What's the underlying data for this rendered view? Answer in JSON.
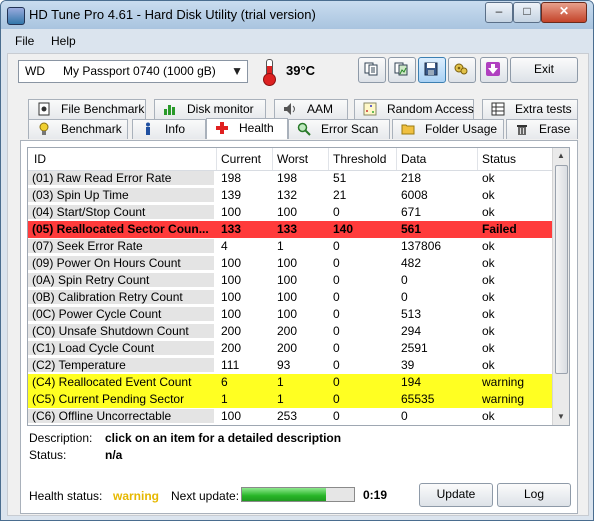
{
  "window": {
    "title": "HD Tune Pro 4.61 - Hard Disk Utility (trial version)",
    "minimize": "–",
    "maximize": "□",
    "close": "✕"
  },
  "menu": {
    "file": "File",
    "help": "Help"
  },
  "toolbar": {
    "drive_brand": "WD",
    "drive_model": "My Passport 0740 (1000 gB)",
    "temperature": "39°C",
    "exit_label": "Exit",
    "icons": [
      "copy-text-icon",
      "copy-screenshot-icon",
      "save-icon",
      "options-icon",
      "download-icon"
    ]
  },
  "tabs_top": [
    {
      "label": "File Benchmark",
      "icon": "file-benchmark-icon"
    },
    {
      "label": "Disk monitor",
      "icon": "disk-monitor-icon"
    },
    {
      "label": "AAM",
      "icon": "speaker-icon"
    },
    {
      "label": "Random Access",
      "icon": "random-access-icon"
    },
    {
      "label": "Extra tests",
      "icon": "extra-tests-icon"
    }
  ],
  "tabs_bottom": [
    {
      "label": "Benchmark",
      "icon": "bulb-icon"
    },
    {
      "label": "Info",
      "icon": "info-icon"
    },
    {
      "label": "Health",
      "icon": "health-cross-icon",
      "active": true
    },
    {
      "label": "Error Scan",
      "icon": "magnifier-icon"
    },
    {
      "label": "Folder Usage",
      "icon": "folder-icon"
    },
    {
      "label": "Erase",
      "icon": "trash-icon"
    }
  ],
  "table": {
    "headers": [
      "ID",
      "Current",
      "Worst",
      "Threshold",
      "Data",
      "Status"
    ],
    "rows": [
      {
        "id": "(01) Raw Read Error Rate",
        "current": "198",
        "worst": "198",
        "threshold": "51",
        "data": "218",
        "status": "ok",
        "state": "normal"
      },
      {
        "id": "(03) Spin Up Time",
        "current": "139",
        "worst": "132",
        "threshold": "21",
        "data": "6008",
        "status": "ok",
        "state": "normal"
      },
      {
        "id": "(04) Start/Stop Count",
        "current": "100",
        "worst": "100",
        "threshold": "0",
        "data": "671",
        "status": "ok",
        "state": "normal"
      },
      {
        "id": "(05) Reallocated Sector Coun...",
        "current": "133",
        "worst": "133",
        "threshold": "140",
        "data": "561",
        "status": "Failed",
        "state": "failed"
      },
      {
        "id": "(07) Seek Error Rate",
        "current": "4",
        "worst": "1",
        "threshold": "0",
        "data": "137806",
        "status": "ok",
        "state": "normal"
      },
      {
        "id": "(09) Power On Hours Count",
        "current": "100",
        "worst": "100",
        "threshold": "0",
        "data": "482",
        "status": "ok",
        "state": "normal"
      },
      {
        "id": "(0A) Spin Retry Count",
        "current": "100",
        "worst": "100",
        "threshold": "0",
        "data": "0",
        "status": "ok",
        "state": "normal"
      },
      {
        "id": "(0B) Calibration Retry Count",
        "current": "100",
        "worst": "100",
        "threshold": "0",
        "data": "0",
        "status": "ok",
        "state": "normal"
      },
      {
        "id": "(0C) Power Cycle Count",
        "current": "100",
        "worst": "100",
        "threshold": "0",
        "data": "513",
        "status": "ok",
        "state": "normal"
      },
      {
        "id": "(C0) Unsafe Shutdown Count",
        "current": "200",
        "worst": "200",
        "threshold": "0",
        "data": "294",
        "status": "ok",
        "state": "normal"
      },
      {
        "id": "(C1) Load Cycle Count",
        "current": "200",
        "worst": "200",
        "threshold": "0",
        "data": "2591",
        "status": "ok",
        "state": "normal"
      },
      {
        "id": "(C2) Temperature",
        "current": "111",
        "worst": "93",
        "threshold": "0",
        "data": "39",
        "status": "ok",
        "state": "normal"
      },
      {
        "id": "(C4) Reallocated Event Count",
        "current": "6",
        "worst": "1",
        "threshold": "0",
        "data": "194",
        "status": "warning",
        "state": "warning"
      },
      {
        "id": "(C5) Current Pending Sector",
        "current": "1",
        "worst": "1",
        "threshold": "0",
        "data": "65535",
        "status": "warning",
        "state": "warning"
      },
      {
        "id": "(C6) Offline Uncorrectable",
        "current": "100",
        "worst": "253",
        "threshold": "0",
        "data": "0",
        "status": "ok",
        "state": "normal"
      }
    ]
  },
  "details": {
    "description_label": "Description:",
    "description_value": "click on an item for a detailed description",
    "status_label": "Status:",
    "status_value": "n/a"
  },
  "footer": {
    "health_label": "Health status:",
    "health_value": "warning",
    "next_update_label": "Next update:",
    "next_update_value": "0:19",
    "progress_fraction": 0.75,
    "update_button": "Update",
    "log_button": "Log"
  },
  "colors": {
    "failed_row": "#ff3b3b",
    "warning_row": "#ffff22",
    "warning_text": "#e6b800",
    "progress": "#27b527"
  }
}
